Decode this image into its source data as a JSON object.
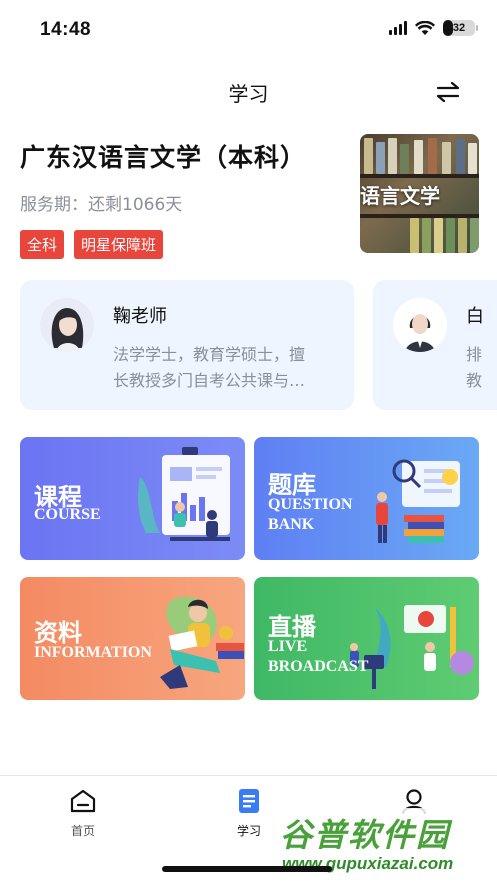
{
  "status_bar": {
    "time": "14:48",
    "battery": "32"
  },
  "header": {
    "title": "学习"
  },
  "course": {
    "title": "广东汉语言文学（本科）",
    "service_period": "服务期：还剩1066天",
    "tags": [
      "全科",
      "明星保障班"
    ],
    "cover_text": "语言文学"
  },
  "teachers": [
    {
      "name": "鞠老师",
      "desc_line1": "法学学士，教育学硕士，擅",
      "desc_line2": "长教授多门自考公共课与…"
    },
    {
      "name": "白",
      "desc_line1": "排",
      "desc_line2": "教"
    }
  ],
  "tiles": {
    "course": {
      "cn": "课程",
      "en": "COURSE"
    },
    "bank": {
      "cn": "题库",
      "en": "QUESTION\nBANK"
    },
    "info": {
      "cn": "资料",
      "en": "INFORMATION"
    },
    "live": {
      "cn": "直播",
      "en": "LIVE\nBROADCAST"
    }
  },
  "tabbar": {
    "home": "首页",
    "study": "学习",
    "active_color": "#3a7bf6"
  },
  "watermark": {
    "cn": "谷普软件园",
    "url": "www.gupuxiazai.com"
  },
  "colors": {
    "tag": "#e8453c",
    "teacher_card": "#eef5fe",
    "course_tile": "#6b74f2",
    "bank_tile": "#5f7ff3",
    "info_tile": "#f48a62",
    "live_tile": "#3fb865"
  }
}
